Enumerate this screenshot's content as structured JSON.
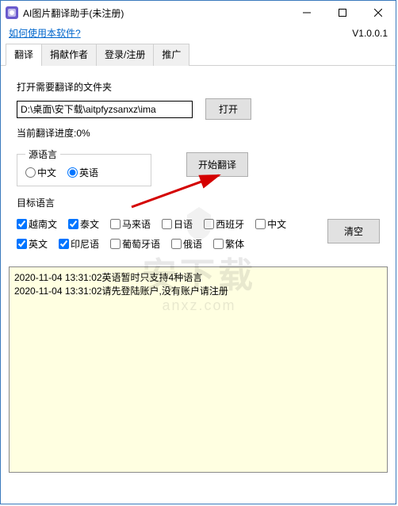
{
  "window": {
    "title": "AI图片翻译助手(未注册)"
  },
  "header": {
    "help_link": "如何使用本软件?",
    "version": "V1.0.0.1"
  },
  "tabs": {
    "items": [
      {
        "label": "翻译"
      },
      {
        "label": "捐献作者"
      },
      {
        "label": "登录/注册"
      },
      {
        "label": "推广"
      }
    ]
  },
  "folder": {
    "label": "打开需要翻译的文件夹",
    "path": "D:\\桌面\\安下载\\aitpfyzsanxz\\ima",
    "open_btn": "打开"
  },
  "progress": {
    "text": "当前翻译进度:0%"
  },
  "source_lang": {
    "legend": "源语言",
    "options": [
      {
        "label": "中文",
        "checked": false
      },
      {
        "label": "英语",
        "checked": true
      }
    ]
  },
  "start_btn": "开始翻译",
  "target_lang": {
    "label": "目标语言",
    "row1": [
      {
        "label": "越南文",
        "checked": true
      },
      {
        "label": "泰文",
        "checked": true
      },
      {
        "label": "马来语",
        "checked": false
      },
      {
        "label": "日语",
        "checked": false
      },
      {
        "label": "西班牙",
        "checked": false
      },
      {
        "label": "中文",
        "checked": false
      }
    ],
    "row2": [
      {
        "label": "英文",
        "checked": true
      },
      {
        "label": "印尼语",
        "checked": true
      },
      {
        "label": "葡萄牙语",
        "checked": false
      },
      {
        "label": "俄语",
        "checked": false
      },
      {
        "label": "繁体",
        "checked": false
      }
    ]
  },
  "clear_btn": "清空",
  "log": {
    "lines": [
      "2020-11-04 13:31:02英语暂时只支持4种语言",
      "2020-11-04 13:31:02请先登陆账户,没有账户请注册"
    ]
  },
  "watermark": {
    "main": "安下载",
    "sub": "anxz.com"
  }
}
